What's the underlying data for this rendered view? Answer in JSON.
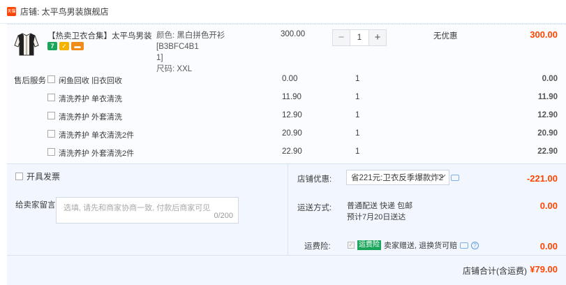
{
  "shop": {
    "icon": "shop-icon",
    "icon_text": "天猫",
    "label": "店铺: 太平鸟男装旗舰店"
  },
  "product": {
    "title": "【热卖卫衣合集】太平鸟男装 ...",
    "badges": [
      {
        "name": "seven-day-return-badge",
        "text": "7"
      },
      {
        "name": "guarantee-badge",
        "text": "✓"
      },
      {
        "name": "card-badge",
        "text": "▬"
      }
    ],
    "color_label": "颜色:",
    "color_value": "黑白拼色开衫[B3BFC4B11]",
    "color_line1": "黑白拼色开衫[B3BFC4B1",
    "color_line2": "1]",
    "size_label": "尺码:",
    "size_value": "XXL",
    "price": "300.00",
    "quantity": "1",
    "minus": "−",
    "plus": "+",
    "discount": "无优惠",
    "subtotal": "300.00"
  },
  "services": {
    "title": "售后服务",
    "items": [
      {
        "name": "闲鱼回收 旧衣回收",
        "price": "0.00",
        "qty": "1",
        "subtotal": "0.00"
      },
      {
        "name": "清洗养护 单衣清洗",
        "price": "11.90",
        "qty": "1",
        "subtotal": "11.90"
      },
      {
        "name": "清洗养护 外套清洗",
        "price": "12.90",
        "qty": "1",
        "subtotal": "12.90"
      },
      {
        "name": "清洗养护 单衣清洗2件",
        "price": "20.90",
        "qty": "1",
        "subtotal": "20.90"
      },
      {
        "name": "清洗养护 外套清洗2件",
        "price": "22.90",
        "qty": "1",
        "subtotal": "22.90"
      }
    ]
  },
  "invoice": {
    "label": "开具发票"
  },
  "message": {
    "label": "给卖家留言:",
    "placeholder": "选填, 请先和商家协商一致, 付款后商家可见",
    "count": "0/200"
  },
  "coupon": {
    "label": "店铺优惠:",
    "value": "省221元:卫衣反季爆款炸2",
    "amount": "-221.00"
  },
  "shipping": {
    "label": "运送方式:",
    "line1": "普通配送 快递 包邮",
    "line2": "预计7月20日送达",
    "amount": "0.00"
  },
  "insurance": {
    "label": "运费险:",
    "badge": "运费险",
    "text": "卖家赠送, 退换货可赔",
    "amount": "0.00"
  },
  "total": {
    "label": "店铺合计(含运费)",
    "value": "¥79.00"
  },
  "colors": {
    "accent_red": "#ff4400",
    "panel_bg": "#f2f7ff",
    "item_bg": "#fbfcff"
  }
}
